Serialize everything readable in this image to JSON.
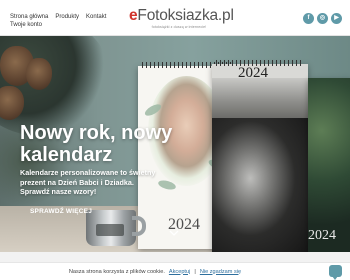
{
  "header": {
    "nav": {
      "row1": [
        "Strona główna",
        "Produkty",
        "Kontakt"
      ],
      "row2": [
        "Twoje konto"
      ]
    },
    "logo": {
      "prefix": "e",
      "name": "Fotoksiazka.pl",
      "tagline": "fotoksiążki z duszą w internecie!"
    },
    "social": [
      {
        "icon": "facebook-icon",
        "glyph": "f"
      },
      {
        "icon": "instagram-icon",
        "glyph": "◎"
      },
      {
        "icon": "youtube-icon",
        "glyph": "▶"
      }
    ]
  },
  "hero": {
    "title": "Nowy rok, nowy kalendarz",
    "description": "Kalendarze personalizowane to świetny prezent na Dzień Babci i Dziadka. Sprawdź nasze wzory!",
    "button_label": "SPRAWDŹ WIĘCEJ",
    "calendar_years": [
      "2024",
      "2024",
      "2024"
    ]
  },
  "cookie_bar": {
    "text": "Nasza strona korzysta z plików cookie.",
    "accept_label": "Akceptuj",
    "reject_label": "Nie zgadzam się"
  },
  "colors": {
    "accent": "#5f9aa8",
    "logo_red": "#d0342c"
  }
}
